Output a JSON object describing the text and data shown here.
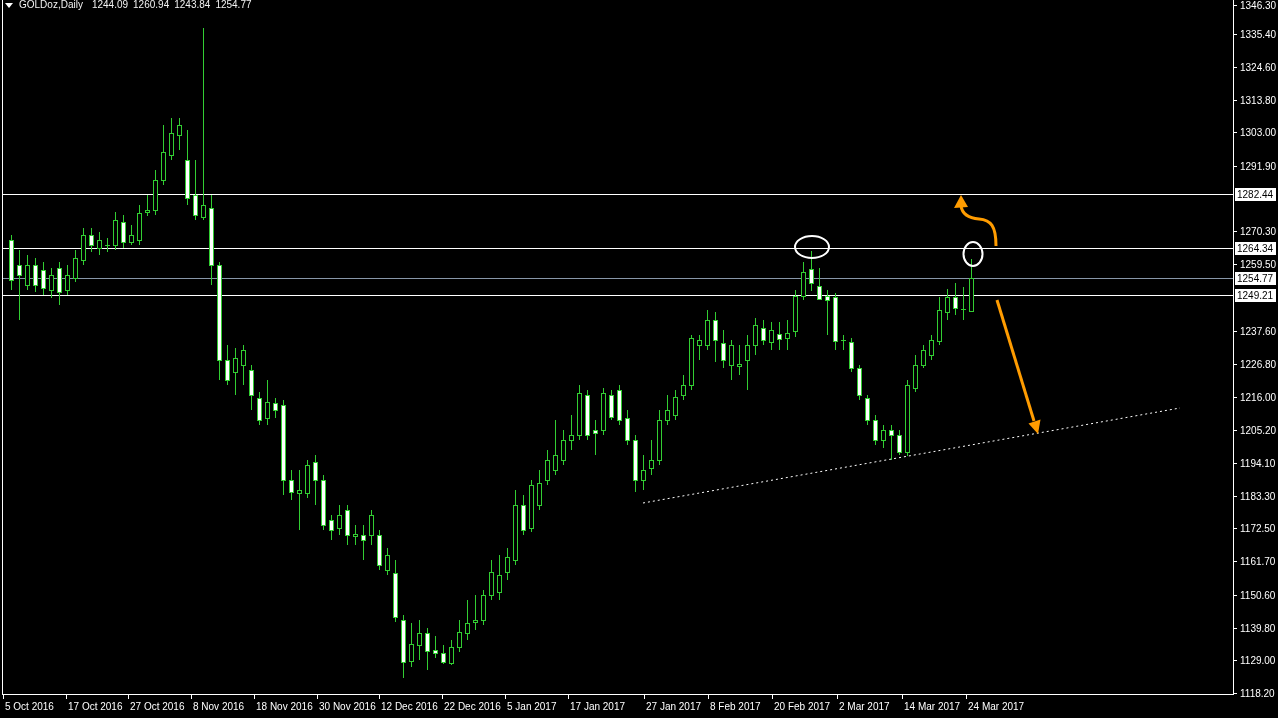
{
  "header": {
    "symbol": "GOLDoz,Daily",
    "ohlc": [
      "1244.09",
      "1260.94",
      "1243.84",
      "1254.77"
    ]
  },
  "price_axis": {
    "labels": [
      "1346.30",
      "1335.40",
      "1324.60",
      "1313.80",
      "1303.00",
      "1291.90",
      "1270.30",
      "1259.50",
      "1237.60",
      "1226.80",
      "1216.00",
      "1205.20",
      "1194.10",
      "1183.30",
      "1172.50",
      "1161.70",
      "1150.60",
      "1139.80",
      "1129.00",
      "1118.20"
    ]
  },
  "price_levels": [
    {
      "label": "1282.44",
      "kind": "line"
    },
    {
      "label": "1264.34",
      "kind": "line"
    },
    {
      "label": "1254.77",
      "kind": "bid"
    },
    {
      "label": "1249.21",
      "kind": "line"
    }
  ],
  "time_axis": {
    "labels": [
      "5 Oct 2016",
      "17 Oct 2016",
      "27 Oct 2016",
      "8 Nov 2016",
      "18 Nov 2016",
      "30 Nov 2016",
      "12 Dec 2016",
      "22 Dec 2016",
      "5 Jan 2017",
      "17 Jan 2017",
      "27 Jan 2017",
      "8 Feb 2017",
      "20 Feb 2017",
      "2 Mar 2017",
      "14 Mar 2017",
      "24 Mar 2017"
    ]
  }
}
